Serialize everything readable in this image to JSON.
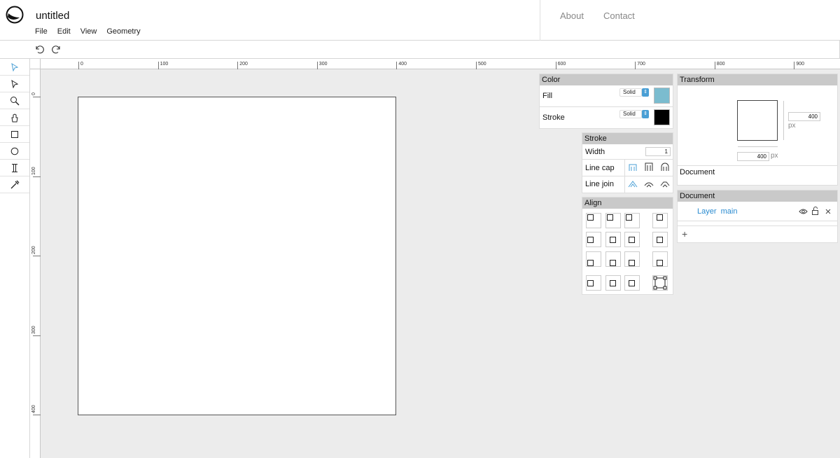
{
  "app": {
    "title": "untitled",
    "menu": [
      "File",
      "Edit",
      "View",
      "Geometry"
    ],
    "nav": [
      "About",
      "Contact"
    ]
  },
  "toolbar": {
    "undo_icon": "undo-icon",
    "redo_icon": "redo-icon"
  },
  "tools": [
    {
      "name": "select-tool",
      "icon": "pointer-icon",
      "active": true
    },
    {
      "name": "direct-select-tool",
      "icon": "direct-pointer-icon",
      "active": false
    },
    {
      "name": "zoom-tool",
      "icon": "zoom-icon",
      "active": false
    },
    {
      "name": "pan-tool",
      "icon": "hand-icon",
      "active": false
    },
    {
      "name": "rectangle-tool",
      "icon": "rectangle-icon",
      "active": false
    },
    {
      "name": "ellipse-tool",
      "icon": "ellipse-icon",
      "active": false
    },
    {
      "name": "text-tool",
      "icon": "text-icon",
      "active": false
    },
    {
      "name": "eyedropper-tool",
      "icon": "eyedropper-icon",
      "active": false
    }
  ],
  "rulers": {
    "horizontal": [
      "0",
      "100",
      "200",
      "300",
      "400",
      "500",
      "600",
      "700",
      "800",
      "900"
    ],
    "vertical": [
      "0",
      "100",
      "200",
      "300",
      "400"
    ]
  },
  "color_panel": {
    "title": "Color",
    "fill_label": "Fill",
    "fill_type": "Solid",
    "fill_color": "#7bbccf",
    "stroke_label": "Stroke",
    "stroke_type": "Solid",
    "stroke_color": "#000000"
  },
  "stroke_panel": {
    "title": "Stroke",
    "width_label": "Width",
    "width_value": "1",
    "linecap_label": "Line cap",
    "linejoin_label": "Line join",
    "accent_color": "#4a9fd5"
  },
  "align_panel": {
    "title": "Align"
  },
  "transform_panel": {
    "title": "Transform",
    "width_value": "400",
    "height_value": "400",
    "unit": "px",
    "footer_label": "Document"
  },
  "document_panel": {
    "title": "Document",
    "layer_label": "Layer",
    "layer_name": "main",
    "add_label": "+"
  }
}
